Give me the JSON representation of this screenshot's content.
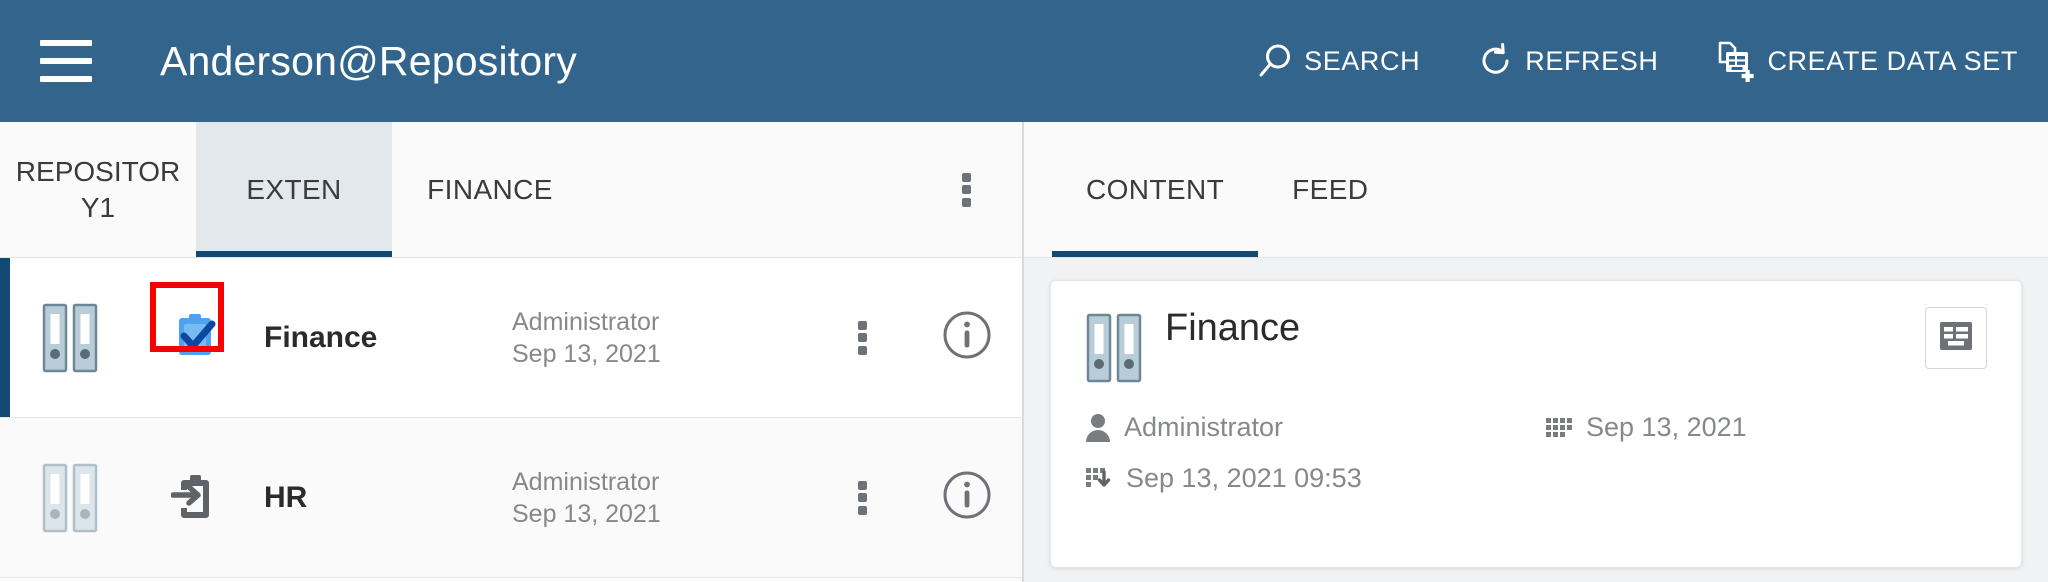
{
  "header": {
    "menu_icon": "hamburger-icon",
    "title": "Anderson@Repository",
    "actions": [
      {
        "icon": "search-icon",
        "label": "SEARCH"
      },
      {
        "icon": "refresh-icon",
        "label": "REFRESH"
      },
      {
        "icon": "create-data-set-icon",
        "label": "CREATE DATA SET"
      }
    ]
  },
  "left_panel": {
    "breadcrumb": "REPOSITORY1",
    "tabs": [
      {
        "label": "EXTEN",
        "active": true
      },
      {
        "label": "FINANCE",
        "active": false
      }
    ],
    "overflow_icon": "kebab-menu-icon",
    "rows": [
      {
        "binder_icon": "binder-folder-icon",
        "type_icon": "clipboard-check-icon",
        "name": "Finance",
        "owner": "Administrator",
        "date": "Sep 13, 2021",
        "kebab_icon": "kebab-menu-icon",
        "info_icon": "info-circle-icon",
        "selected": true,
        "highlighted": true
      },
      {
        "binder_icon": "binder-folder-icon",
        "type_icon": "clipboard-import-icon",
        "name": "HR",
        "owner": "Administrator",
        "date": "Sep 13, 2021",
        "kebab_icon": "kebab-menu-icon",
        "info_icon": "info-circle-icon",
        "selected": false,
        "highlighted": false
      }
    ]
  },
  "right_panel": {
    "tabs": [
      {
        "label": "CONTENT",
        "active": true
      },
      {
        "label": "FEED",
        "active": false
      }
    ],
    "detail": {
      "binder_icon": "binder-folder-icon",
      "title": "Finance",
      "action_icon": "properties-table-icon",
      "owner_icon": "person-icon",
      "owner": "Administrator",
      "date_icon": "calendar-grid-icon",
      "date": "Sep 13, 2021",
      "modified_icon": "calendar-import-icon",
      "modified": "Sep 13, 2021 09:53"
    }
  },
  "colors": {
    "header_blue": "#33658C",
    "accent_blue": "#134a74",
    "highlight_red": "#f80000",
    "active_tab_bg": "#e3e8ec"
  }
}
